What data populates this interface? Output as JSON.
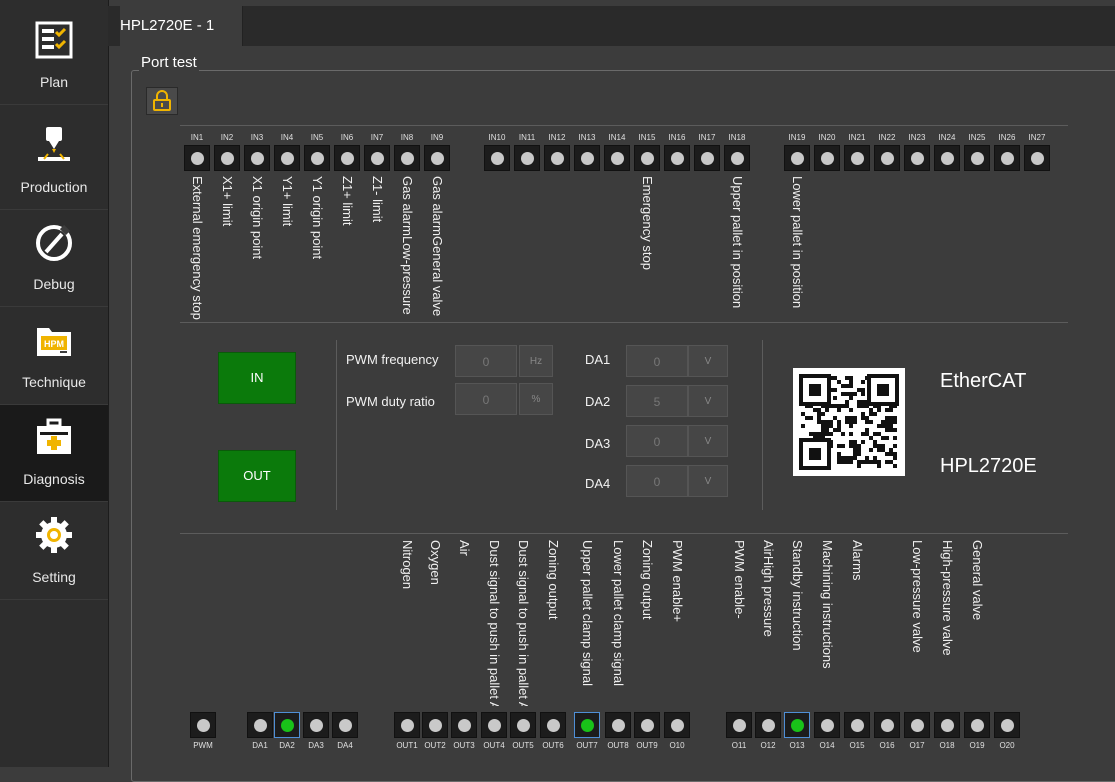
{
  "sidebar": {
    "items": [
      {
        "label": "Plan",
        "icon": "plan-icon"
      },
      {
        "label": "Production",
        "icon": "production-icon"
      },
      {
        "label": "Debug",
        "icon": "debug-icon"
      },
      {
        "label": "Technique",
        "icon": "technique-icon",
        "badge": "HPM"
      },
      {
        "label": "Diagnosis",
        "icon": "diagnosis-icon",
        "active": true
      },
      {
        "label": "Setting",
        "icon": "gear-icon"
      }
    ]
  },
  "tab": {
    "title": "HPL2720E - 1"
  },
  "group": {
    "title": "Port test"
  },
  "inputs": {
    "ids": [
      "IN1",
      "IN2",
      "IN3",
      "IN4",
      "IN5",
      "IN6",
      "IN7",
      "IN8",
      "IN9",
      "IN10",
      "IN11",
      "IN12",
      "IN13",
      "IN14",
      "IN15",
      "IN16",
      "IN17",
      "IN18",
      "IN19",
      "IN20",
      "IN21",
      "IN22",
      "IN23",
      "IN24",
      "IN25",
      "IN26",
      "IN27"
    ],
    "labels": [
      "External emergency stop",
      "X1+ limit",
      "X1 origin point",
      "Y1+ limit",
      "Y1 origin point",
      "Z1+ limit",
      "Z1- limit",
      "Gas alarmLow-pressure",
      "Gas alarmGeneral valve",
      "Emergency stop",
      "Upper pallet in position",
      "Lower pallet in position"
    ],
    "states": [
      0,
      0,
      0,
      0,
      0,
      0,
      0,
      0,
      0,
      0,
      0,
      0,
      0,
      0,
      0,
      0,
      0,
      0,
      0,
      0,
      0,
      0,
      0,
      0,
      0,
      0,
      0
    ]
  },
  "middle": {
    "in_button": "IN",
    "out_button": "OUT",
    "pwm_frequency": {
      "label": "PWM frequency",
      "value": "0",
      "unit": "Hz"
    },
    "pwm_duty": {
      "label": "PWM duty ratio",
      "value": "0",
      "unit": "%"
    },
    "da": [
      {
        "label": "DA1",
        "value": "0",
        "unit": "V"
      },
      {
        "label": "DA2",
        "value": "5",
        "unit": "V"
      },
      {
        "label": "DA3",
        "value": "0",
        "unit": "V"
      },
      {
        "label": "DA4",
        "value": "0",
        "unit": "V"
      }
    ],
    "bus": "EtherCAT",
    "model": "HPL2720E"
  },
  "outputs": {
    "pwm": "PWM",
    "da_ids": [
      "DA1",
      "DA2",
      "DA3",
      "DA4"
    ],
    "da_states": [
      0,
      1,
      0,
      0
    ],
    "ids": [
      "OUT1",
      "OUT2",
      "OUT3",
      "OUT4",
      "OUT5",
      "OUT6",
      "OUT7",
      "OUT8",
      "OUT9",
      "O10",
      "O11",
      "O12",
      "O13",
      "O14",
      "O15",
      "O16",
      "O17",
      "O18",
      "O19",
      "O20"
    ],
    "states": [
      0,
      0,
      0,
      0,
      0,
      0,
      1,
      0,
      0,
      0,
      0,
      0,
      1,
      0,
      0,
      0,
      0,
      0,
      0,
      0
    ],
    "labels": [
      "Nitrogen",
      "Oxygen",
      "Air",
      "Dust signal to push in pallet A",
      "Dust signal to push in pallet A",
      "Zoning output",
      "Upper pallet clamp signal",
      "Lower pallet clamp signal",
      "Zoning output",
      "PWM enable+",
      "PWM enable-",
      "AirHigh pressure",
      "Standby instruction",
      "Machining instructions",
      "Alarms",
      "Low-pressure valve",
      "High-pressure valve",
      "General valve"
    ]
  }
}
